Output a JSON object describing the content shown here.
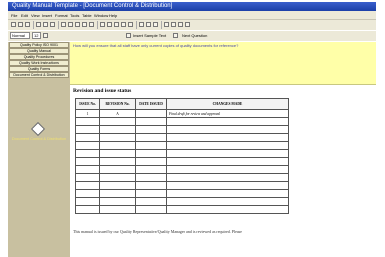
{
  "window": {
    "title": "Quality Manual Template - [Document Control & Distribution]"
  },
  "menu": [
    "File",
    "Edit",
    "View",
    "Insert",
    "Format",
    "Tools",
    "Table",
    "Window",
    "Help"
  ],
  "toolbar": {
    "style_value": "Normal",
    "size_value": "12",
    "insert_sample_label": "Insert Sample Text",
    "next_question_label": "Next Question"
  },
  "sidebar": {
    "items": [
      "Quality Policy ISO 9001",
      "Quality Manual",
      "Quality Procedures",
      "Quality Work Instructions",
      "Quality Forms",
      "Document Control & Distribution"
    ],
    "selected_label": "Document Control & Distribution"
  },
  "doc": {
    "question": "How will you ensure that all staff have only current copies of quality documents for reference?",
    "section_title": "Revision and issue status",
    "table": {
      "headers": [
        "ISSUE No.",
        "REVISION No.",
        "DATE ISSUED",
        "CHANGES MADE"
      ],
      "rows": [
        [
          "1",
          "A",
          "",
          "Final draft for review and approval"
        ],
        [
          "",
          "",
          "",
          ""
        ],
        [
          "",
          "",
          "",
          ""
        ],
        [
          "",
          "",
          "",
          ""
        ],
        [
          "",
          "",
          "",
          ""
        ],
        [
          "",
          "",
          "",
          ""
        ],
        [
          "",
          "",
          "",
          ""
        ],
        [
          "",
          "",
          "",
          ""
        ],
        [
          "",
          "",
          "",
          ""
        ],
        [
          "",
          "",
          "",
          ""
        ],
        [
          "",
          "",
          "",
          ""
        ],
        [
          "",
          "",
          "",
          ""
        ],
        [
          "",
          "",
          "",
          ""
        ]
      ]
    },
    "footer": "This manual is issued by our Quality Representative/Quality Manager and is reviewed as required. Please"
  }
}
